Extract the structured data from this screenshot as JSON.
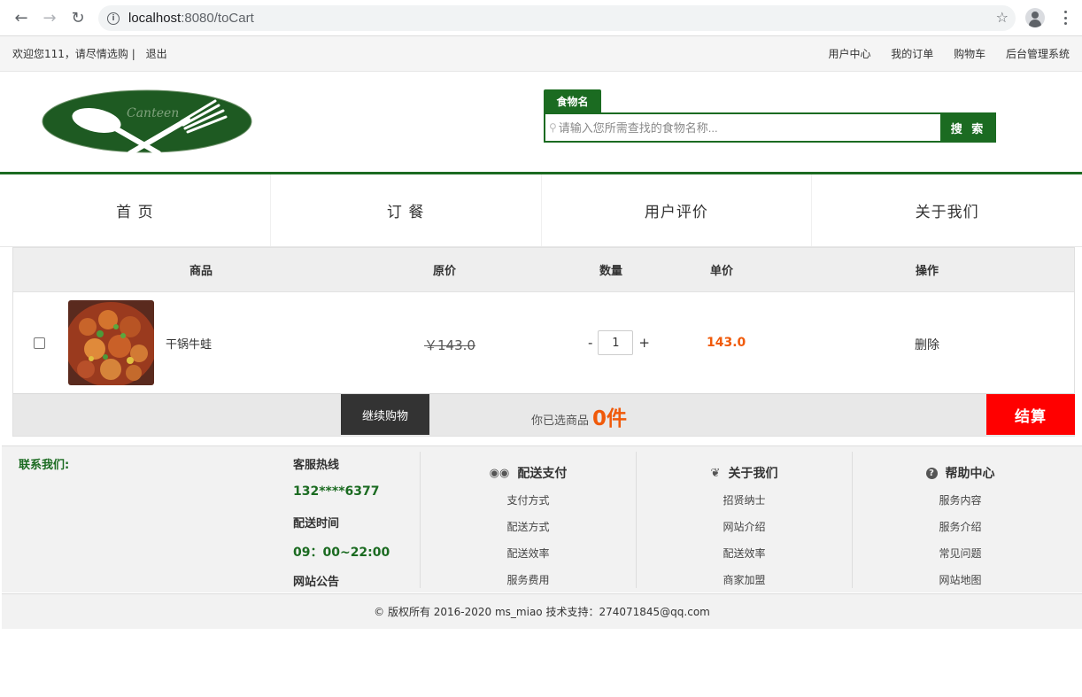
{
  "browser": {
    "url_host": "localhost",
    "url_rest": ":8080/toCart"
  },
  "topbar": {
    "welcome": "欢迎您111，请尽情选购 |",
    "logout": "退出",
    "links": [
      "用户中心",
      "我的订单",
      "购物车",
      "后台管理系统"
    ]
  },
  "header": {
    "logo_text": "Canteen",
    "search_tab": "食物名",
    "search_placeholder": "请输入您所需查找的食物名称...",
    "search_button": "搜 索"
  },
  "mainnav": [
    "首 页",
    "订 餐",
    "用户评价",
    "关于我们"
  ],
  "cart": {
    "headers": {
      "product": "商品",
      "original_price": "原价",
      "quantity": "数量",
      "unit_price": "单价",
      "action": "操作"
    },
    "items": [
      {
        "name": "干锅牛蛙",
        "original_price": "￥143.0",
        "quantity": "1",
        "unit_price": "143.0",
        "delete": "删除"
      }
    ],
    "qty_minus": "-",
    "qty_plus": "+",
    "continue_button": "继续购物",
    "selected_label": "你已选商品",
    "selected_count": "0件",
    "checkout_button": "结算"
  },
  "footer": {
    "contact_title": "联系我们:",
    "hotline_label": "客服热线",
    "hotline_value": "132****6377",
    "delivery_time_label": "配送时间",
    "delivery_time_value": "09：00~22:00",
    "notice_label": "网站公告",
    "columns": [
      {
        "title": "配送支付",
        "icon": "bicycle-icon",
        "items": [
          "支付方式",
          "配送方式",
          "配送效率",
          "服务费用"
        ]
      },
      {
        "title": "关于我们",
        "icon": "leaf-icon",
        "items": [
          "招贤纳士",
          "网站介绍",
          "配送效率",
          "商家加盟"
        ]
      },
      {
        "title": "帮助中心",
        "icon": "help-icon",
        "items": [
          "服务内容",
          "服务介绍",
          "常见问题",
          "网站地图"
        ]
      }
    ]
  },
  "copyright": "© 版权所有 2016-2020   ms_miao 技术支持：274071845@qq.com",
  "colors": {
    "brand_green": "#1b6b21",
    "price_orange": "#f05a0a",
    "checkout_red": "#ff0000"
  }
}
